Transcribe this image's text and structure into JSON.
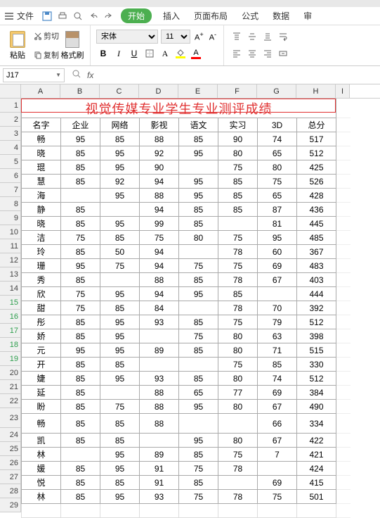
{
  "menubar": {
    "file": "文件",
    "start_tab": "开始",
    "insert": "插入",
    "page_layout": "页面布局",
    "formula": "公式",
    "data": "数据",
    "review": "审"
  },
  "ribbon": {
    "paste": "粘贴",
    "cut": "剪切",
    "copy": "复制",
    "format_painter": "格式刷",
    "font_name": "宋体",
    "font_size": "11",
    "bold": "B",
    "italic": "I",
    "underline": "U",
    "fill_color": "#ffff00",
    "font_color": "#ff0000"
  },
  "namebox": "J17",
  "fx": "fx",
  "columns": [
    "A",
    "B",
    "C",
    "D",
    "E",
    "F",
    "G",
    "H",
    "I"
  ],
  "row_nums": [
    "1",
    "2",
    "3",
    "4",
    "5",
    "6",
    "7",
    "8",
    "9",
    "10",
    "11",
    "12",
    "13",
    "14",
    "15",
    "16",
    "17",
    "18",
    "19",
    "20",
    "21",
    "22",
    "23",
    "24",
    "25",
    "26",
    "27",
    "28",
    "29"
  ],
  "green_rows": [
    "15",
    "16",
    "17",
    "18",
    "19"
  ],
  "title": "视觉传媒专业学生专业测评成绩",
  "headers": [
    "名字",
    "企业",
    "网络",
    "影视",
    "语文",
    "实习",
    "3D",
    "总分"
  ],
  "rows": [
    [
      "畅",
      "95",
      "85",
      "88",
      "85",
      "90",
      "74",
      "517"
    ],
    [
      "晓",
      "85",
      "95",
      "92",
      "95",
      "80",
      "65",
      "512"
    ],
    [
      "琨",
      "85",
      "95",
      "90",
      "",
      "75",
      "80",
      "425"
    ],
    [
      "慧",
      "85",
      "92",
      "94",
      "95",
      "85",
      "75",
      "526"
    ],
    [
      "海",
      "",
      "95",
      "88",
      "95",
      "85",
      "65",
      "428"
    ],
    [
      "静",
      "85",
      "",
      "94",
      "85",
      "85",
      "87",
      "436"
    ],
    [
      "晓",
      "85",
      "95",
      "99",
      "85",
      "",
      "81",
      "445"
    ],
    [
      "洁",
      "75",
      "85",
      "75",
      "80",
      "75",
      "95",
      "485"
    ],
    [
      "玲",
      "85",
      "50",
      "94",
      "",
      "78",
      "60",
      "367"
    ],
    [
      "珊",
      "95",
      "75",
      "94",
      "75",
      "75",
      "69",
      "483"
    ],
    [
      "秀",
      "85",
      "",
      "88",
      "85",
      "78",
      "67",
      "403"
    ],
    [
      "欣",
      "75",
      "95",
      "94",
      "95",
      "85",
      "",
      "444"
    ],
    [
      "甜",
      "75",
      "85",
      "84",
      "",
      "78",
      "70",
      "392"
    ],
    [
      "彤",
      "85",
      "95",
      "93",
      "85",
      "75",
      "79",
      "512"
    ],
    [
      "娇",
      "85",
      "95",
      "",
      "75",
      "80",
      "63",
      "398"
    ],
    [
      "元",
      "95",
      "95",
      "89",
      "85",
      "80",
      "71",
      "515"
    ],
    [
      "开",
      "85",
      "85",
      "",
      "",
      "75",
      "85",
      "330"
    ],
    [
      "婕",
      "85",
      "95",
      "93",
      "85",
      "80",
      "74",
      "512"
    ],
    [
      "延",
      "85",
      "",
      "88",
      "65",
      "77",
      "69",
      "384"
    ],
    [
      "盼",
      "85",
      "75",
      "88",
      "95",
      "80",
      "67",
      "490"
    ],
    [
      "畅",
      "85",
      "85",
      "88",
      "",
      "",
      "66",
      "334"
    ],
    [
      "凯",
      "85",
      "85",
      "",
      "95",
      "80",
      "67",
      "422"
    ],
    [
      "林",
      "",
      "95",
      "89",
      "85",
      "75",
      "7",
      "421"
    ],
    [
      "媛",
      "85",
      "95",
      "91",
      "75",
      "78",
      "",
      "424"
    ],
    [
      "悦",
      "85",
      "85",
      "91",
      "85",
      "",
      "69",
      "415"
    ],
    [
      "林",
      "85",
      "95",
      "93",
      "75",
      "78",
      "75",
      "501"
    ]
  ],
  "chart_data": {
    "type": "table",
    "title": "视觉传媒专业学生专业测评成绩",
    "columns": [
      "名字",
      "企业",
      "网络",
      "影视",
      "语文",
      "实习",
      "3D",
      "总分"
    ],
    "data": [
      [
        "畅",
        95,
        85,
        88,
        85,
        90,
        74,
        517
      ],
      [
        "晓",
        85,
        95,
        92,
        95,
        80,
        65,
        512
      ],
      [
        "琨",
        85,
        95,
        90,
        null,
        75,
        80,
        425
      ],
      [
        "慧",
        85,
        92,
        94,
        95,
        85,
        75,
        526
      ],
      [
        "海",
        null,
        95,
        88,
        95,
        85,
        65,
        428
      ],
      [
        "静",
        85,
        null,
        94,
        85,
        85,
        87,
        436
      ],
      [
        "晓",
        85,
        95,
        99,
        85,
        null,
        81,
        445
      ],
      [
        "洁",
        75,
        85,
        75,
        80,
        75,
        95,
        485
      ],
      [
        "玲",
        85,
        50,
        94,
        null,
        78,
        60,
        367
      ],
      [
        "珊",
        95,
        75,
        94,
        75,
        75,
        69,
        483
      ],
      [
        "秀",
        85,
        null,
        88,
        85,
        78,
        67,
        403
      ],
      [
        "欣",
        75,
        95,
        94,
        95,
        85,
        null,
        444
      ],
      [
        "甜",
        75,
        85,
        84,
        null,
        78,
        70,
        392
      ],
      [
        "彤",
        85,
        95,
        93,
        85,
        75,
        79,
        512
      ],
      [
        "娇",
        85,
        95,
        null,
        75,
        80,
        63,
        398
      ],
      [
        "元",
        95,
        95,
        89,
        85,
        80,
        71,
        515
      ],
      [
        "开",
        85,
        85,
        null,
        null,
        75,
        85,
        330
      ],
      [
        "婕",
        85,
        95,
        93,
        85,
        80,
        74,
        512
      ],
      [
        "延",
        85,
        null,
        88,
        65,
        77,
        69,
        384
      ],
      [
        "盼",
        85,
        75,
        88,
        95,
        80,
        67,
        490
      ],
      [
        "畅",
        85,
        85,
        88,
        null,
        null,
        66,
        334
      ],
      [
        "凯",
        85,
        85,
        null,
        95,
        80,
        67,
        422
      ],
      [
        "林",
        null,
        95,
        89,
        85,
        75,
        7,
        421
      ],
      [
        "媛",
        85,
        95,
        91,
        75,
        78,
        null,
        424
      ],
      [
        "悦",
        85,
        85,
        91,
        85,
        null,
        69,
        415
      ],
      [
        "林",
        85,
        95,
        93,
        75,
        78,
        75,
        501
      ]
    ]
  }
}
